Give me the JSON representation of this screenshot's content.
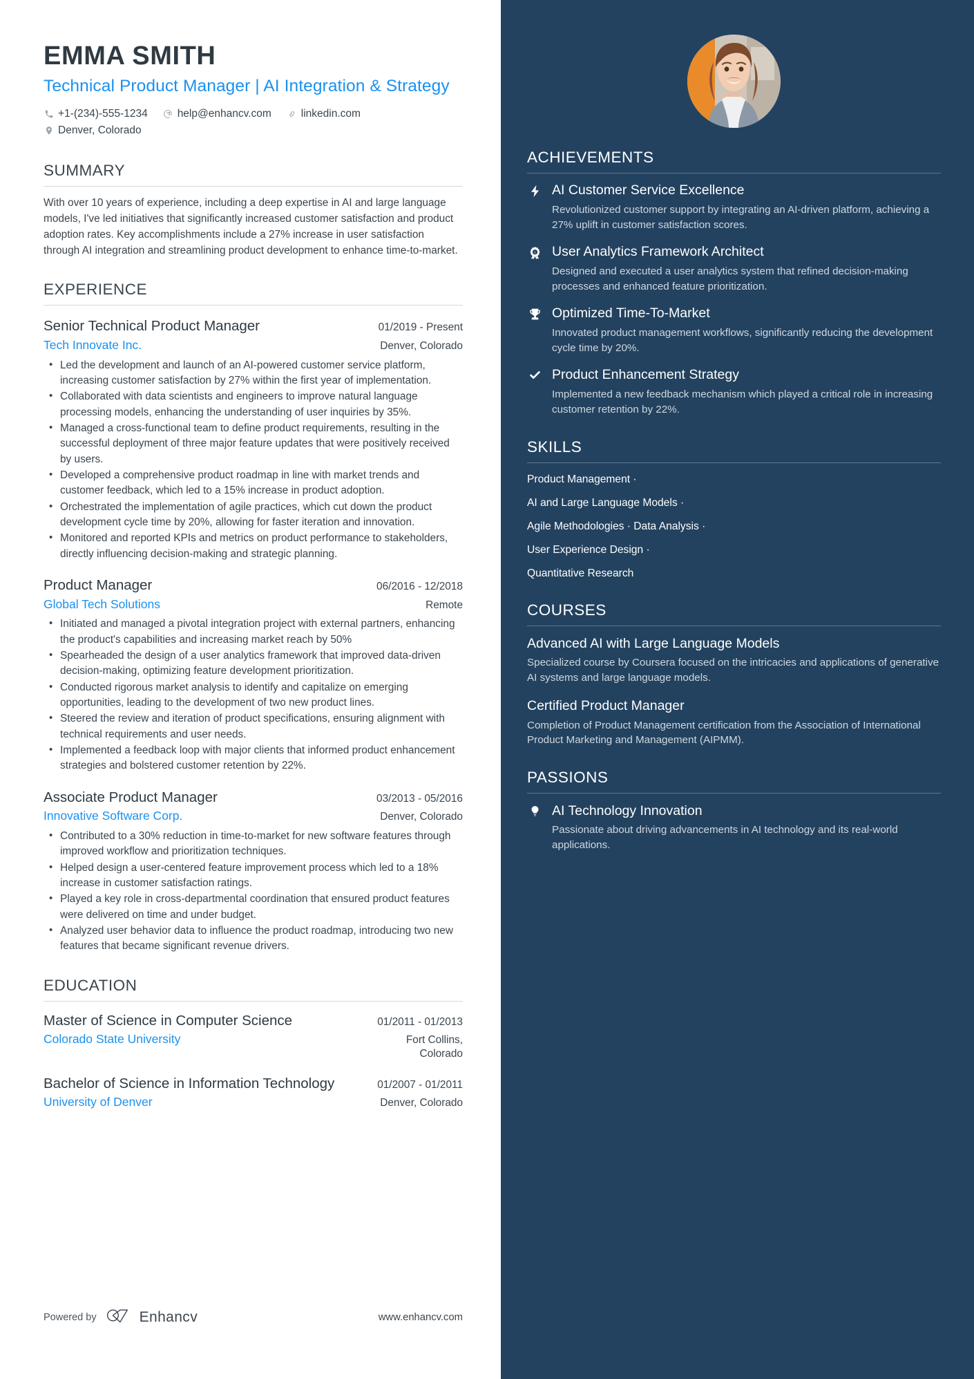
{
  "colors": {
    "accent_blue": "#1a91f0",
    "sidebar_bg": "#23425f",
    "text_dark": "#3b454d",
    "muted_light": "#cfd8e0"
  },
  "header": {
    "name": "EMMA SMITH",
    "headline": "Technical Product Manager | AI Integration & Strategy",
    "contacts": [
      {
        "icon": "phone-icon",
        "text": "+1-(234)-555-1234"
      },
      {
        "icon": "email-icon",
        "text": "help@enhancv.com"
      },
      {
        "icon": "link-icon",
        "text": "linkedin.com"
      },
      {
        "icon": "location-icon",
        "text": "Denver, Colorado"
      }
    ]
  },
  "summary": {
    "title": "SUMMARY",
    "text": "With over 10 years of experience, including a deep expertise in AI and large language models, I've led initiatives that significantly increased customer satisfaction and product adoption rates. Key accomplishments include a 27% increase in user satisfaction through AI integration and streamlining product development to enhance time-to-market."
  },
  "experience": {
    "title": "EXPERIENCE",
    "jobs": [
      {
        "title": "Senior Technical Product Manager",
        "dates": "01/2019 - Present",
        "company": "Tech Innovate Inc.",
        "location": "Denver, Colorado",
        "bullets": [
          "Led the development and launch of an AI-powered customer service platform, increasing customer satisfaction by 27% within the first year of implementation.",
          "Collaborated with data scientists and engineers to improve natural language processing models, enhancing the understanding of user inquiries by 35%.",
          "Managed a cross-functional team to define product requirements, resulting in the successful deployment of three major feature updates that were positively received by users.",
          "Developed a comprehensive product roadmap in line with market trends and customer feedback, which led to a 15% increase in product adoption.",
          "Orchestrated the implementation of agile practices, which cut down the product development cycle time by 20%, allowing for faster iteration and innovation.",
          "Monitored and reported KPIs and metrics on product performance to stakeholders, directly influencing decision-making and strategic planning."
        ]
      },
      {
        "title": "Product Manager",
        "dates": "06/2016 - 12/2018",
        "company": "Global Tech Solutions",
        "location": "Remote",
        "bullets": [
          "Initiated and managed a pivotal integration project with external partners, enhancing the product's capabilities and increasing market reach by 50%",
          "Spearheaded the design of a user analytics framework that improved data-driven decision-making, optimizing feature development prioritization.",
          "Conducted rigorous market analysis to identify and capitalize on emerging opportunities, leading to the development of two new product lines.",
          "Steered the review and iteration of product specifications, ensuring alignment with technical requirements and user needs.",
          "Implemented a feedback loop with major clients that informed product enhancement strategies and bolstered customer retention by 22%."
        ]
      },
      {
        "title": "Associate Product Manager",
        "dates": "03/2013 - 05/2016",
        "company": "Innovative Software Corp.",
        "location": "Denver, Colorado",
        "bullets": [
          "Contributed to a 30% reduction in time-to-market for new software features through improved workflow and prioritization techniques.",
          "Helped design a user-centered feature improvement process which led to a 18% increase in customer satisfaction ratings.",
          "Played a key role in cross-departmental coordination that ensured product features were delivered on time and under budget.",
          "Analyzed user behavior data to influence the product roadmap, introducing two new features that became significant revenue drivers."
        ]
      }
    ]
  },
  "education": {
    "title": "EDUCATION",
    "items": [
      {
        "degree": "Master of Science in Computer Science",
        "dates": "01/2011 - 01/2013",
        "school": "Colorado State University",
        "location": "Fort Collins,\nColorado"
      },
      {
        "degree": "Bachelor of Science in Information Technology",
        "dates": "01/2007 - 01/2011",
        "school": "University of Denver",
        "location": "Denver, Colorado"
      }
    ]
  },
  "footer": {
    "powered_by": "Powered by",
    "brand": "Enhancv",
    "website": "www.enhancv.com"
  },
  "achievements": {
    "title": "ACHIEVEMENTS",
    "items": [
      {
        "icon": "lightning-bolt-icon",
        "title": "AI Customer Service Excellence",
        "desc": "Revolutionized customer support by integrating an AI-driven platform, achieving a 27% uplift in customer satisfaction scores."
      },
      {
        "icon": "award-badge-icon",
        "title": "User Analytics Framework Architect",
        "desc": "Designed and executed a user analytics system that refined decision-making processes and enhanced feature prioritization."
      },
      {
        "icon": "trophy-icon",
        "title": "Optimized Time-To-Market",
        "desc": "Innovated product management workflows, significantly reducing the development cycle time by 20%."
      },
      {
        "icon": "checkmark-icon",
        "title": "Product Enhancement Strategy",
        "desc": "Implemented a new feedback mechanism which played a critical role in increasing customer retention by 22%."
      }
    ]
  },
  "skills": {
    "title": "SKILLS",
    "lines": [
      "Product Management ·",
      "AI and Large Language Models ·",
      "Agile Methodologies · Data Analysis ·",
      "User Experience Design ·",
      "Quantitative Research"
    ]
  },
  "courses": {
    "title": "COURSES",
    "items": [
      {
        "title": "Advanced AI with Large Language Models",
        "desc": "Specialized course by Coursera focused on the intricacies and applications of generative AI systems and large language models."
      },
      {
        "title": "Certified Product Manager",
        "desc": "Completion of Product Management certification from the Association of International Product Marketing and Management (AIPMM)."
      }
    ]
  },
  "passions": {
    "title": "PASSIONS",
    "items": [
      {
        "icon": "lightbulb-icon",
        "title": "AI Technology Innovation",
        "desc": "Passionate about driving advancements in AI technology and its real-world applications."
      }
    ]
  }
}
